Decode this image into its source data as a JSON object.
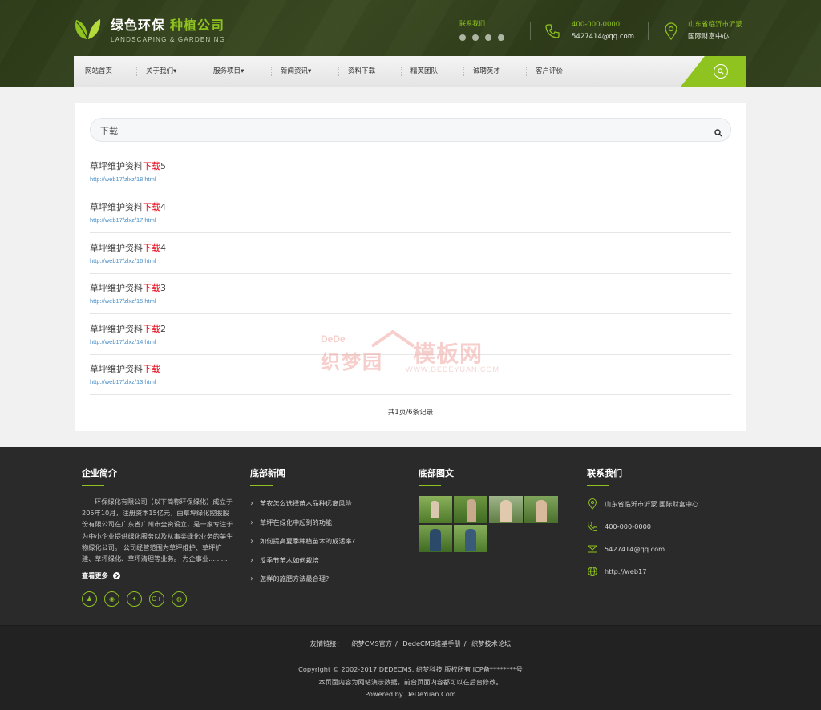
{
  "brand": {
    "name_main": "绿色环保",
    "name_highlight": "种植公司",
    "tagline": "LANDSCAPING & GARDENING",
    "accent": "#8fc31f"
  },
  "header": {
    "contact_label": "联系我们",
    "social_icons": [
      "wechat-icon",
      "qq-icon",
      "pinterest-icon",
      "weibo-icon"
    ],
    "phone": "400-000-0000",
    "email": "5427414@qq.com",
    "address_line1": "山东省临沂市沂蒙",
    "address_line2": "国际财富中心"
  },
  "nav": {
    "items": [
      {
        "label": "网站首页"
      },
      {
        "label": "关于我们▾"
      },
      {
        "label": "服务项目▾"
      },
      {
        "label": "新闻资讯▾"
      },
      {
        "label": "资料下载"
      },
      {
        "label": "精英团队"
      },
      {
        "label": "诚聘英才"
      },
      {
        "label": "客户评价"
      }
    ]
  },
  "search": {
    "value": "下载"
  },
  "results": [
    {
      "title_prefix": "草坪维护资料",
      "keyword": "下载",
      "title_suffix": "5",
      "url": "http://web17/zlxz/18.html"
    },
    {
      "title_prefix": "草坪维护资料",
      "keyword": "下载",
      "title_suffix": "4",
      "url": "http://web17/zlxz/17.html"
    },
    {
      "title_prefix": "草坪维护资料",
      "keyword": "下载",
      "title_suffix": "4",
      "url": "http://web17/zlxz/16.html"
    },
    {
      "title_prefix": "草坪维护资料",
      "keyword": "下载",
      "title_suffix": "3",
      "url": "http://web17/zlxz/15.html"
    },
    {
      "title_prefix": "草坪维护资料",
      "keyword": "下载",
      "title_suffix": "2",
      "url": "http://web17/zlxz/14.html"
    },
    {
      "title_prefix": "草坪维护资料",
      "keyword": "下载",
      "title_suffix": "",
      "url": "http://web17/zlxz/13.html"
    }
  ],
  "pager": {
    "text": "共1页/6条记录"
  },
  "watermark": {
    "brand": "DeDe",
    "cn1": "织梦园",
    "cn2": "模板网",
    "url": "WWW.DEDEYUAN.COM"
  },
  "footer": {
    "intro": {
      "title": "企业简介",
      "text": "环保绿化有限公司（以下简称环保绿化）成立于205年10月，注册资本15亿元，由草坪绿化控股股份有限公司在广东省广州市全资设立，是一家专注于为中小企业提供绿化服务以及从事类绿化业务的美生物绿化公司。 公司经营范围为草坪维护、草坪扩建、草坪绿化、草坪清理等业务。 为企事业.........",
      "more": "查看更多"
    },
    "news": {
      "title": "底部新闻",
      "items": [
        "苗农怎么选择苗木品种远离风险",
        "草坪在绿化中起到的功能",
        "如何提高夏季种植苗木的成活率?",
        "反季节苗木如何栽培",
        "怎样的施肥方法最合理？"
      ]
    },
    "gallery": {
      "title": "底部图文",
      "count": 6
    },
    "contact": {
      "title": "联系我们",
      "address": "山东省临沂市沂蒙 国际财富中心",
      "phone": "400-000-0000",
      "email": "5427414@qq.com",
      "site": "http://web17"
    },
    "social_icons": [
      "qq-icon",
      "weibo-icon",
      "twitter-icon",
      "google-plus-icon",
      "wechat-icon"
    ]
  },
  "bottom": {
    "links_label": "友情链接：",
    "links": [
      "织梦CMS官方",
      "DedeCMS维基手册",
      "织梦技术论坛"
    ],
    "copyright": "Copyright © 2002-2017 DEDECMS. 织梦科技 版权所有 ICP备********号",
    "notice": "本页面内容为网站演示数据，前台页面内容都可以在后台修改。",
    "powered": "Powered by DeDeYuan.Com"
  }
}
